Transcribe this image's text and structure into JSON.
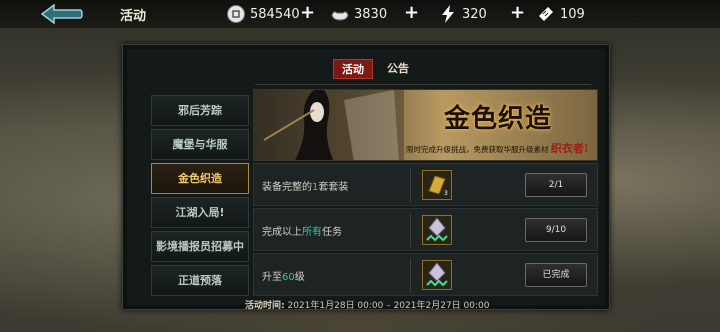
{
  "header": {
    "title": "活动",
    "back_icon": "back-arrow-icon",
    "resources": [
      {
        "name": "coin",
        "icon": "coin-icon",
        "value": "584540"
      },
      {
        "name": "silver",
        "icon": "silver-ingot-icon",
        "value": "3830"
      },
      {
        "name": "energy",
        "icon": "lightning-icon",
        "value": "320"
      },
      {
        "name": "ticket",
        "icon": "ticket-icon",
        "value": "109"
      }
    ]
  },
  "tabs": [
    {
      "label": "活动",
      "active": true
    },
    {
      "label": "公告",
      "active": false
    }
  ],
  "sidebar": {
    "items": [
      {
        "label": "邪后芳踪",
        "active": false
      },
      {
        "label": "魔堡与华服",
        "active": false
      },
      {
        "label": "金色织造",
        "active": true
      },
      {
        "label": "江湖入局!",
        "active": false
      },
      {
        "label": "影境播报员招募中",
        "active": false
      },
      {
        "label": "正道预落",
        "active": false
      }
    ]
  },
  "banner": {
    "title": "金色织造",
    "desc": "限时完成升级挑战，免费获取华服升级素材",
    "desc_highlight": "织衣者!"
  },
  "tasks": [
    {
      "label_pre": "装备完整的",
      "label_hl": "1",
      "label_post": "套套装",
      "reward_icon": "gold-fabric-icon",
      "reward_qty": "3",
      "status": "2/1"
    },
    {
      "label_pre": "完成以上",
      "label_hl": "所有",
      "label_post": "任务",
      "reward_icon": "costume-crystal-icon",
      "reward_qty": "",
      "status": "9/10"
    },
    {
      "label_pre": "升至",
      "label_hl": "60",
      "label_post": "级",
      "reward_icon": "costume-crystal-icon",
      "reward_qty": "",
      "status": "已完成"
    }
  ],
  "event_time": {
    "label": "活动时间:",
    "value": "2021年1月28日 00:00 – 2021年2月27日 00:00"
  },
  "colors": {
    "accent_red": "#7a1a14",
    "highlight_green": "#2fc8a3",
    "active_gold": "#f1c86a"
  }
}
